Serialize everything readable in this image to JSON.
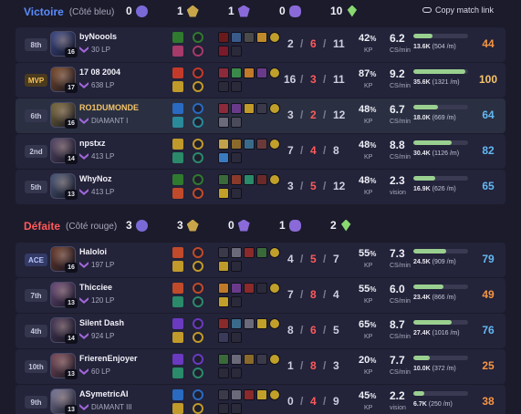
{
  "win_header": {
    "result": "Victoire",
    "side": "(Côté bleu)",
    "kills": "0",
    "towers": "1",
    "dragons": "1",
    "barons": "0",
    "gold": "10",
    "copy_link": "Copy match link"
  },
  "loss_header": {
    "result": "Défaite",
    "side": "(Côté rouge)",
    "kills": "3",
    "towers": "3",
    "dragons": "0",
    "barons": "1",
    "gold": "2"
  },
  "colors": {
    "win": "#5b8cff",
    "loss": "#ff5a5a",
    "gold": "#f5c469",
    "blue_score": "#63b8f2",
    "orange_score": "#f59542"
  },
  "blue_team": [
    {
      "rank": "8th",
      "badge": "",
      "name": "byNoools",
      "lp": "30 LP",
      "level": "16",
      "k": "2",
      "d": "6",
      "a": "11",
      "kp": "42",
      "cs": "6.2",
      "cs_label": "CS/min",
      "bar": 0.35,
      "dmg": "13.6K",
      "dmg_detail": "(504 /m)",
      "score": "44",
      "score_color": "orange",
      "champ": "#3b4a8a",
      "spells": [
        "#2f7a2f",
        "#a63a6b"
      ],
      "items": [
        "#6a1a1a",
        "#3a5a8a",
        "#4a4a4a",
        "#c08a2a",
        "#7a1a2a",
        "#2a2a3a"
      ]
    },
    {
      "rank": "MVP",
      "badge": "mvp",
      "name": "17 08 2004",
      "lp": "638 LP",
      "level": "17",
      "k": "16",
      "d": "3",
      "a": "11",
      "kp": "87",
      "cs": "9.2",
      "cs_label": "CS/min",
      "bar": 0.95,
      "dmg": "35.6K",
      "dmg_detail": "(1321 /m)",
      "score": "100",
      "score_color": "gold",
      "champ": "#7a4a2a",
      "spells": [
        "#c43a2a",
        "#c09a2a"
      ],
      "items": [
        "#8a2a3a",
        "#3a8a4a",
        "#c07a2a",
        "#6a3a8a",
        "#2a2a3a",
        "#2a2a3a"
      ]
    },
    {
      "rank": "6th",
      "badge": "",
      "name": "RO1DUMONDE",
      "lp": "DIAMANT I",
      "level": "16",
      "k": "3",
      "d": "2",
      "a": "12",
      "kp": "48",
      "cs": "6.7",
      "cs_label": "CS/min",
      "bar": 0.45,
      "dmg": "18.0K",
      "dmg_detail": "(669 /m)",
      "score": "64",
      "score_color": "blue",
      "champ": "#7a6a3a",
      "spells": [
        "#2a6ac0",
        "#2a8a9a"
      ],
      "items": [
        "#8a2a3a",
        "#6a3a8a",
        "#c09a2a",
        "#3a3a4a",
        "#6a6a7a",
        "#4a4a5a"
      ],
      "highlight": true,
      "gold_name": true
    },
    {
      "rank": "2nd",
      "badge": "",
      "name": "npstxz",
      "lp": "413 LP",
      "level": "14",
      "k": "7",
      "d": "4",
      "a": "8",
      "kp": "48",
      "cs": "8.8",
      "cs_label": "CS/min",
      "bar": 0.7,
      "dmg": "30.4K",
      "dmg_detail": "(1126 /m)",
      "score": "82",
      "score_color": "blue",
      "champ": "#5a4a6a",
      "spells": [
        "#c09a2a",
        "#2a8a6a"
      ],
      "items": [
        "#c0a04a",
        "#8a6a2a",
        "#3a6a8a",
        "#6a3a3a",
        "#3a7ac0",
        "#2a2a3a"
      ]
    },
    {
      "rank": "5th",
      "badge": "",
      "name": "WhyNoz",
      "lp": "413 LP",
      "level": "13",
      "k": "3",
      "d": "5",
      "a": "12",
      "kp": "48",
      "cs": "2.3",
      "cs_label": "vision",
      "bar": 0.4,
      "dmg": "16.9K",
      "dmg_detail": "(626 /m)",
      "score": "65",
      "score_color": "blue",
      "champ": "#4a5a7a",
      "spells": [
        "#2f7a2f",
        "#c04a2a"
      ],
      "items": [
        "#3a6a3a",
        "#8a3a2a",
        "#2a8a6a",
        "#6a2a2a",
        "#c0a02a",
        "#2a2a3a"
      ]
    }
  ],
  "red_team": [
    {
      "rank": "ACE",
      "badge": "ace",
      "name": "Haloloi",
      "lp": "197 LP",
      "level": "16",
      "k": "4",
      "d": "5",
      "a": "7",
      "kp": "55",
      "cs": "7.3",
      "cs_label": "CS/min",
      "bar": 0.6,
      "dmg": "24.5K",
      "dmg_detail": "(909 /m)",
      "score": "79",
      "score_color": "blue",
      "champ": "#6a3a2a",
      "spells": [
        "#c04a2a",
        "#c09a2a"
      ],
      "items": [
        "#3a3a4a",
        "#6a6a7a",
        "#8a2a2a",
        "#3a6a3a",
        "#c09a2a",
        "#2a2a3a"
      ]
    },
    {
      "rank": "7th",
      "badge": "",
      "name": "Thicciee",
      "lp": "120 LP",
      "level": "13",
      "k": "7",
      "d": "8",
      "a": "4",
      "kp": "55",
      "cs": "6.0",
      "cs_label": "CS/min",
      "bar": 0.55,
      "dmg": "23.4K",
      "dmg_detail": "(866 /m)",
      "score": "49",
      "score_color": "orange",
      "champ": "#6a4a7a",
      "spells": [
        "#c04a2a",
        "#2a8a6a"
      ],
      "items": [
        "#c07a2a",
        "#6a3a8a",
        "#8a2a2a",
        "#2a2a3a",
        "#c0a02a",
        "#2a2a3a"
      ]
    },
    {
      "rank": "4th",
      "badge": "",
      "name": "Silent Dash",
      "lp": "924 LP",
      "level": "14",
      "k": "8",
      "d": "6",
      "a": "5",
      "kp": "65",
      "cs": "8.7",
      "cs_label": "CS/min",
      "bar": 0.7,
      "dmg": "27.4K",
      "dmg_detail": "(1016 /m)",
      "score": "76",
      "score_color": "blue",
      "champ": "#4a3a5a",
      "spells": [
        "#6a3ac0",
        "#c09a2a"
      ],
      "items": [
        "#8a2a2a",
        "#3a6a8a",
        "#6a6a7a",
        "#c0a02a",
        "#3a3a5a",
        "#2a2a3a"
      ]
    },
    {
      "rank": "10th",
      "badge": "",
      "name": "FrierenEnjoyer",
      "lp": "60 LP",
      "level": "13",
      "k": "1",
      "d": "8",
      "a": "3",
      "kp": "20",
      "cs": "7.7",
      "cs_label": "CS/min",
      "bar": 0.3,
      "dmg": "10.0K",
      "dmg_detail": "(372 /m)",
      "score": "25",
      "score_color": "orange",
      "champ": "#7a4a5a",
      "spells": [
        "#6a3ac0",
        "#2a8a6a"
      ],
      "items": [
        "#3a6a3a",
        "#6a6a7a",
        "#8a6a2a",
        "#3a3a4a",
        "#2a2a3a",
        "#2a2a3a"
      ]
    },
    {
      "rank": "9th",
      "badge": "",
      "name": "ASymetricAI",
      "lp": "DIAMANT III",
      "level": "13",
      "k": "0",
      "d": "4",
      "a": "9",
      "kp": "45",
      "cs": "2.2",
      "cs_label": "vision",
      "bar": 0.2,
      "dmg": "6.7K",
      "dmg_detail": "(250 /m)",
      "score": "38",
      "score_color": "orange",
      "champ": "#7a7a9a",
      "spells": [
        "#2a6ac0",
        "#c09a2a"
      ],
      "items": [
        "#3a3a4a",
        "#6a6a7a",
        "#8a2a2a",
        "#c0a02a",
        "#2a2a3a",
        "#2a2a3a"
      ]
    }
  ]
}
